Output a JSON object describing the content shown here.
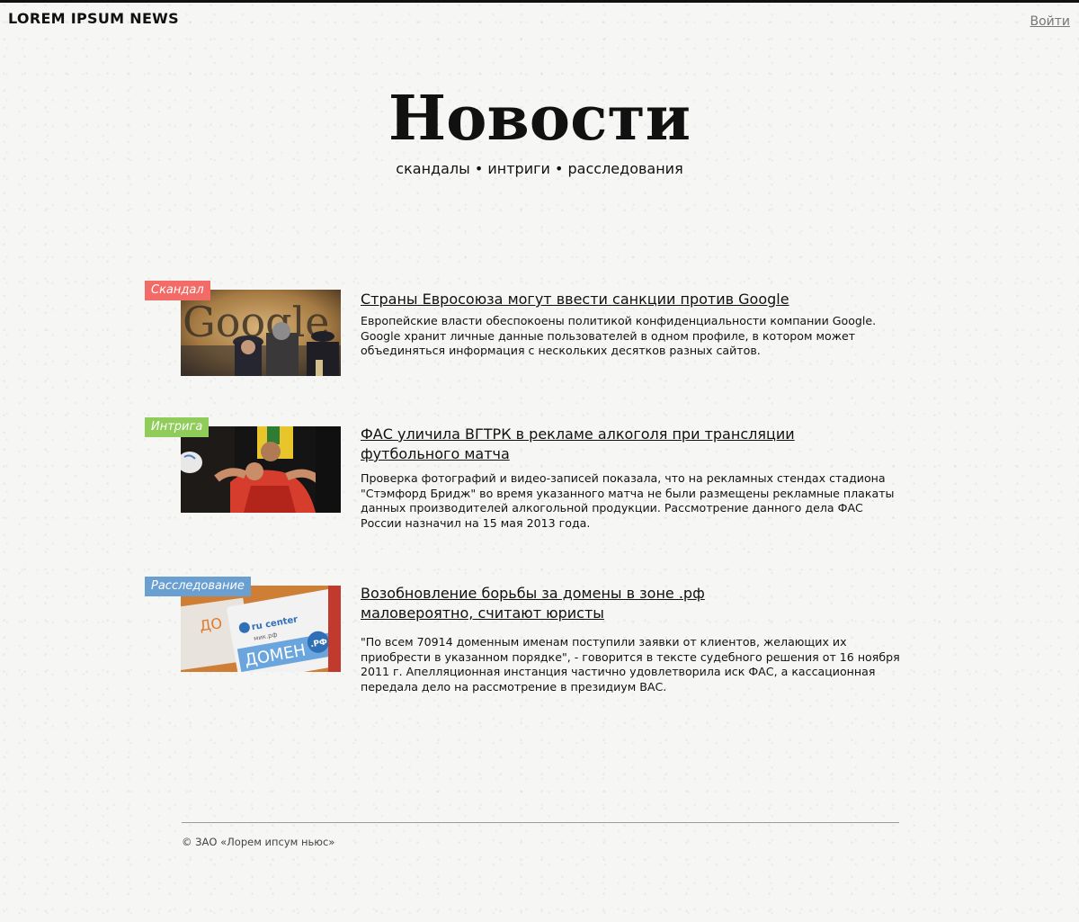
{
  "header": {
    "brand": "LOREM IPSUM NEWS",
    "login_label": "Войти"
  },
  "hero": {
    "title": "Новости",
    "subtitle": "скандалы • интриги • расследования"
  },
  "articles": [
    {
      "tag": "Скандал",
      "tag_color": "#f26b66",
      "image": "google-logo-police-photo",
      "title": "Страны Евросоюза могут ввести санкции против Google",
      "summary": "Европейские власти обеспокоены политикой конфиденциальности компании Google. Google хранит личные данные пользователей в одном профиле, в котором может объединяться информация с нескольких десятков разных сайтов."
    },
    {
      "tag": "Интрига",
      "tag_color": "#8fcc5a",
      "image": "football-players-photo",
      "title": "ФАС уличила ВГТРК в рекламе алкоголя при трансляции футбольного матча",
      "summary": "Проверка фотографий и видео-записей показала, что на рекламных стендах стадиона \"Стэмфорд Бридж\" во время указанного матча не были размещены рекламные плакаты данных производителей алкогольной продукции. Рассмотрение данного дела ФАС России назначил на 15 мая 2013 года."
    },
    {
      "tag": "Расследование",
      "tag_color": "#6a9fd1",
      "image": "domain-rf-cards-photo",
      "title": "Возобновление борьбы за домены в зоне .рф маловероятно, считают юристы",
      "summary": "\"По всем 70914 доменным именам поступили заявки от клиентов, желающих их приобрести в указанном порядке\", - говорится в тексте судебного решения от 16 ноября 2011 г. Апелляционная инстанция частично удовлетворила иск ФАС, а кассационная передала дело на рассмотрение в президиум ВАС."
    }
  ],
  "thumb_text": {
    "google_word": "Google",
    "card_brand": "ru center",
    "card_domain": "ДОМЕН",
    "card_zone": ".РФ",
    "card_small": "мик.рф"
  },
  "footer": {
    "copyright": "© ЗАО «Лорем ипсум ньюс»"
  }
}
